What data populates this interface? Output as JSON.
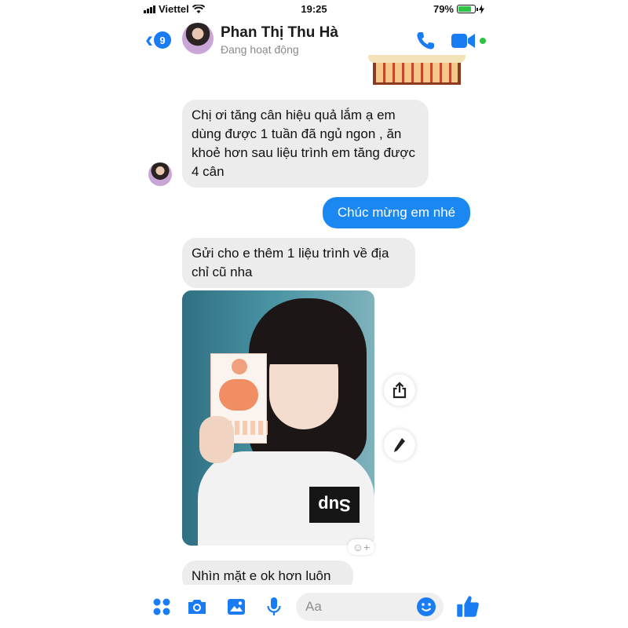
{
  "status_bar": {
    "carrier": "Viettel",
    "time": "19:25",
    "battery": "79%",
    "battery_level": 0.79
  },
  "header": {
    "back_count": "9",
    "contact_name": "Phan Thị Thu Hà",
    "status": "Đang hoạt động"
  },
  "messages": [
    {
      "from": "contact",
      "text": "Chị ơi tăng cân hiệu quả lắm ạ em dùng được 1 tuần đã ngủ ngon , ăn khoẻ hơn sau liệu trình em tăng được 4 cân"
    },
    {
      "from": "me",
      "text": "Chúc mừng em nhé"
    },
    {
      "from": "contact",
      "text": "Gửi cho e thêm 1 liệu trình về địa chỉ cũ nha"
    },
    {
      "from": "contact",
      "type": "photo",
      "shirt_text": "Sup"
    },
    {
      "from": "contact",
      "text": "Nhìn mặt e ok hơn luôn"
    }
  ],
  "composer": {
    "placeholder": "Aa"
  },
  "colors": {
    "accent": "#1a7cf2",
    "incoming_bubble": "#ececec",
    "outgoing_bubble": "#1a88f0",
    "video_dot": "#2dc445"
  },
  "icons": [
    "back-chevron-icon",
    "phone-icon",
    "video-camera-icon",
    "share-icon",
    "pencil-icon",
    "add-reaction-icon",
    "apps-grid-icon",
    "camera-icon",
    "gallery-icon",
    "microphone-icon",
    "emoji-icon",
    "thumbs-up-icon"
  ]
}
